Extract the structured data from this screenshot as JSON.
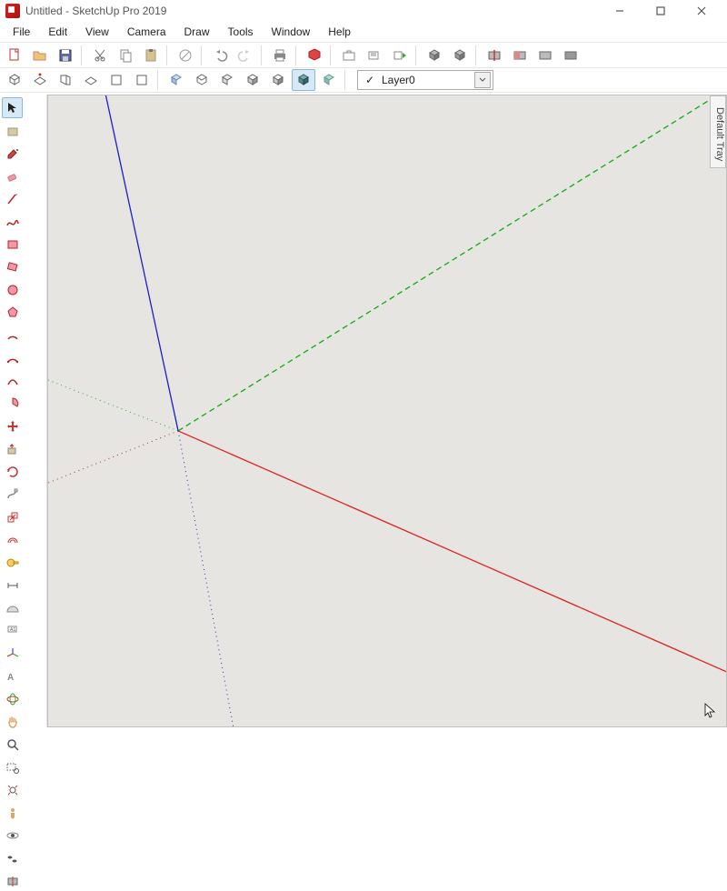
{
  "window": {
    "title": "Untitled - SketchUp Pro 2019"
  },
  "menu": {
    "items": [
      "File",
      "Edit",
      "View",
      "Camera",
      "Draw",
      "Tools",
      "Window",
      "Help"
    ]
  },
  "layer": {
    "checked": "✓",
    "name": "Layer0"
  },
  "tray": {
    "label": "Default Tray"
  }
}
